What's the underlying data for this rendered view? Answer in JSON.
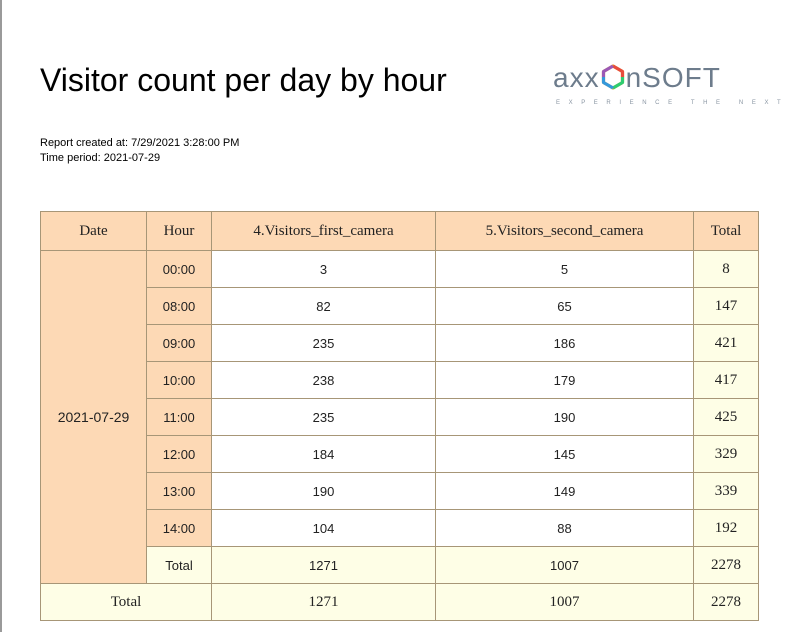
{
  "report": {
    "title": "Visitor count per day by hour",
    "created_label": "Report created at:",
    "created_value": "7/29/2021 3:28:00 PM",
    "period_label": "Time period:",
    "period_value": "2021-07-29"
  },
  "logo": {
    "text_pre": "axx",
    "text_post": "nSOFT",
    "tagline": "EXPERIENCE THE NEXT"
  },
  "table": {
    "headers": [
      "Date",
      "Hour",
      "4.Visitors_first_camera",
      "5.Visitors_second_camera",
      "Total"
    ],
    "date": "2021-07-29",
    "rows": [
      {
        "hour": "00:00",
        "first": "3",
        "second": "5",
        "total": "8"
      },
      {
        "hour": "08:00",
        "first": "82",
        "second": "65",
        "total": "147"
      },
      {
        "hour": "09:00",
        "first": "235",
        "second": "186",
        "total": "421"
      },
      {
        "hour": "10:00",
        "first": "238",
        "second": "179",
        "total": "417"
      },
      {
        "hour": "11:00",
        "first": "235",
        "second": "190",
        "total": "425"
      },
      {
        "hour": "12:00",
        "first": "184",
        "second": "145",
        "total": "329"
      },
      {
        "hour": "13:00",
        "first": "190",
        "second": "149",
        "total": "339"
      },
      {
        "hour": "14:00",
        "first": "104",
        "second": "88",
        "total": "192"
      }
    ],
    "subtotal": {
      "label": "Total",
      "first": "1271",
      "second": "1007",
      "total": "2278"
    },
    "grand_total": {
      "label": "Total",
      "first": "1271",
      "second": "1007",
      "total": "2278"
    }
  },
  "colors": {
    "header_bg": "#fdd9b5",
    "total_bg": "#fefee6",
    "border": "#a79677"
  }
}
